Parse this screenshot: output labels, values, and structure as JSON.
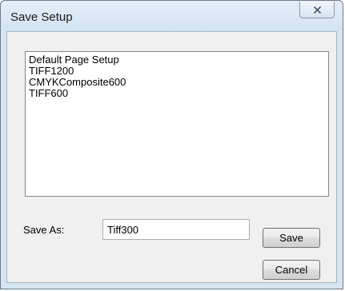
{
  "window": {
    "title": "Save Setup"
  },
  "setups_list": {
    "items": [
      "Default Page Setup",
      "TIFF1200",
      "CMYKComposite600",
      "TIFF600"
    ]
  },
  "save_as": {
    "label": "Save As:",
    "value": "Tiff300"
  },
  "buttons": {
    "save_label": "Save",
    "cancel_label": "Cancel"
  },
  "icons": {
    "close": "close-icon"
  }
}
